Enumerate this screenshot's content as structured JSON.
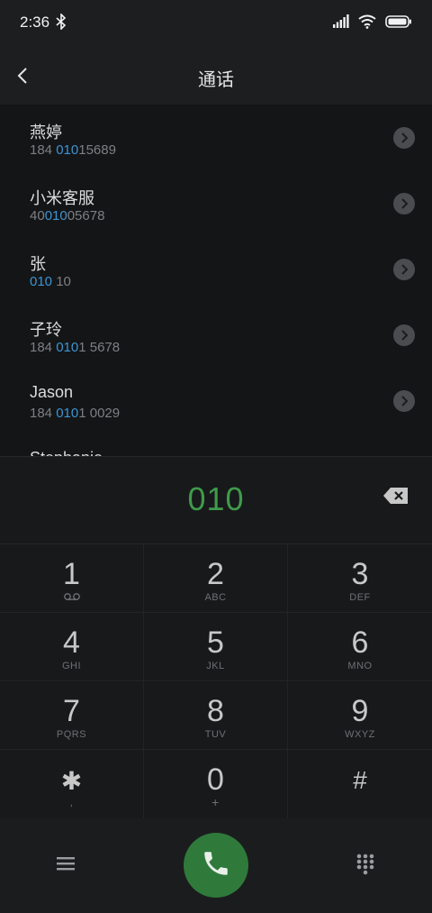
{
  "status_bar": {
    "time": "2:36"
  },
  "header": {
    "title": "通话"
  },
  "results": [
    {
      "name": "燕婷",
      "num_pre": "184 ",
      "num_hl": "010",
      "num_post": "15689"
    },
    {
      "name": "小米客服",
      "num_pre": "40",
      "num_hl": "010",
      "num_post": "05678"
    },
    {
      "name": "张",
      "num_pre": "",
      "num_hl": "010",
      "num_post": " 10"
    },
    {
      "name": "子玲",
      "num_pre": "184 ",
      "num_hl": "010",
      "num_post": "1 5678"
    },
    {
      "name": "Jason",
      "num_pre": "184 ",
      "num_hl": "010",
      "num_post": "1 0029"
    },
    {
      "name": "Stephanie",
      "num_pre": "",
      "num_hl": "",
      "num_post": ""
    }
  ],
  "dialer": {
    "digits": "010"
  },
  "keypad": [
    {
      "digit": "1",
      "letters": ""
    },
    {
      "digit": "2",
      "letters": "ABC"
    },
    {
      "digit": "3",
      "letters": "DEF"
    },
    {
      "digit": "4",
      "letters": "GHI"
    },
    {
      "digit": "5",
      "letters": "JKL"
    },
    {
      "digit": "6",
      "letters": "MNO"
    },
    {
      "digit": "7",
      "letters": "PQRS"
    },
    {
      "digit": "8",
      "letters": "TUV"
    },
    {
      "digit": "9",
      "letters": "WXYZ"
    },
    {
      "digit": "✱",
      "letters": ","
    },
    {
      "digit": "0",
      "letters": "+"
    },
    {
      "digit": "#",
      "letters": ""
    }
  ],
  "colors": {
    "accent_green": "#3f9a4b",
    "highlight_blue": "#3b95d3",
    "call_button": "#2f7a3a"
  },
  "icons": [
    "bluetooth-icon",
    "signal-icon",
    "wifi-icon",
    "battery-icon",
    "back-icon",
    "chevron-right-icon",
    "backspace-icon",
    "voicemail-icon",
    "menu-icon",
    "phone-icon",
    "dialpad-icon"
  ]
}
